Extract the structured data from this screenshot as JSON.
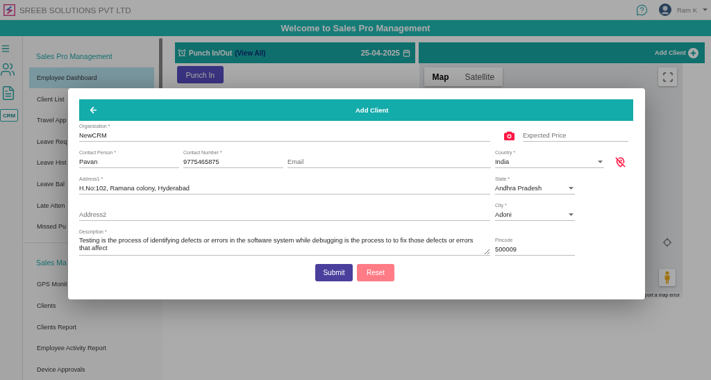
{
  "header": {
    "company": "SREEB SOLUTIONS PVT LTD",
    "user": "Ram K"
  },
  "title_bar": {
    "title": "Welcome to Sales Pro Management"
  },
  "icon_rail": {
    "crm_label": "CRM"
  },
  "sidebar": {
    "sections": [
      {
        "title": "Sales Pro Management",
        "items": [
          {
            "label": "Employee Dashboard",
            "selected": true
          },
          {
            "label": "Client List",
            "selected": false
          },
          {
            "label": "Travel App",
            "selected": false
          },
          {
            "label": "Leave Req",
            "selected": false
          },
          {
            "label": "Leave Hist",
            "selected": false
          },
          {
            "label": "Leave Bal",
            "selected": false
          },
          {
            "label": "Late Atten",
            "selected": false
          },
          {
            "label": "Missed Pu",
            "selected": false
          }
        ]
      },
      {
        "title": "Sales Ma",
        "items": [
          {
            "label": "GPS Monit",
            "selected": false
          },
          {
            "label": "Clients",
            "selected": false
          },
          {
            "label": "Clients Report",
            "selected": false
          },
          {
            "label": "Employee Activity Report",
            "selected": false
          },
          {
            "label": "Device Approvals",
            "selected": false
          }
        ]
      }
    ]
  },
  "punch_panel": {
    "title": "Punch In/Out",
    "link": "(View All)",
    "date": "25-04-2025",
    "button": "Punch In"
  },
  "client_panel": {
    "button": "Add Client"
  },
  "map": {
    "tabs": [
      {
        "label": "Map",
        "selected": true
      },
      {
        "label": "Satellite",
        "selected": false
      }
    ],
    "report_link": "port a map error"
  },
  "modal": {
    "title": "Add Client",
    "fields": {
      "organization": {
        "label": "Organization *",
        "value": "NewCRM"
      },
      "expected_price": {
        "placeholder": "Expected Price"
      },
      "contact_person": {
        "label": "Contact Person *",
        "value": "Pavan"
      },
      "contact_number": {
        "label": "Contact Number *",
        "value": "9775465875"
      },
      "email": {
        "placeholder": "Email"
      },
      "country": {
        "label": "Country *",
        "value": "India"
      },
      "address1": {
        "label": "Address1 *",
        "value": "H.No:102, Ramana colony, Hyderabad"
      },
      "state": {
        "label": "State *",
        "value": "Andhra Pradesh"
      },
      "address2": {
        "placeholder": "Address2"
      },
      "city": {
        "label": "City *",
        "value": "Adoni"
      },
      "description": {
        "label": "Description *",
        "value": "Testing is the process of identifying defects or errors in the software system while debugging is the process to to fix those defects or errors that affect"
      },
      "pincode": {
        "label": "Pincode",
        "value": "500009"
      }
    },
    "buttons": [
      {
        "label": "Submit",
        "kind": "submit"
      },
      {
        "label": "Reset",
        "kind": "reset"
      }
    ]
  }
}
